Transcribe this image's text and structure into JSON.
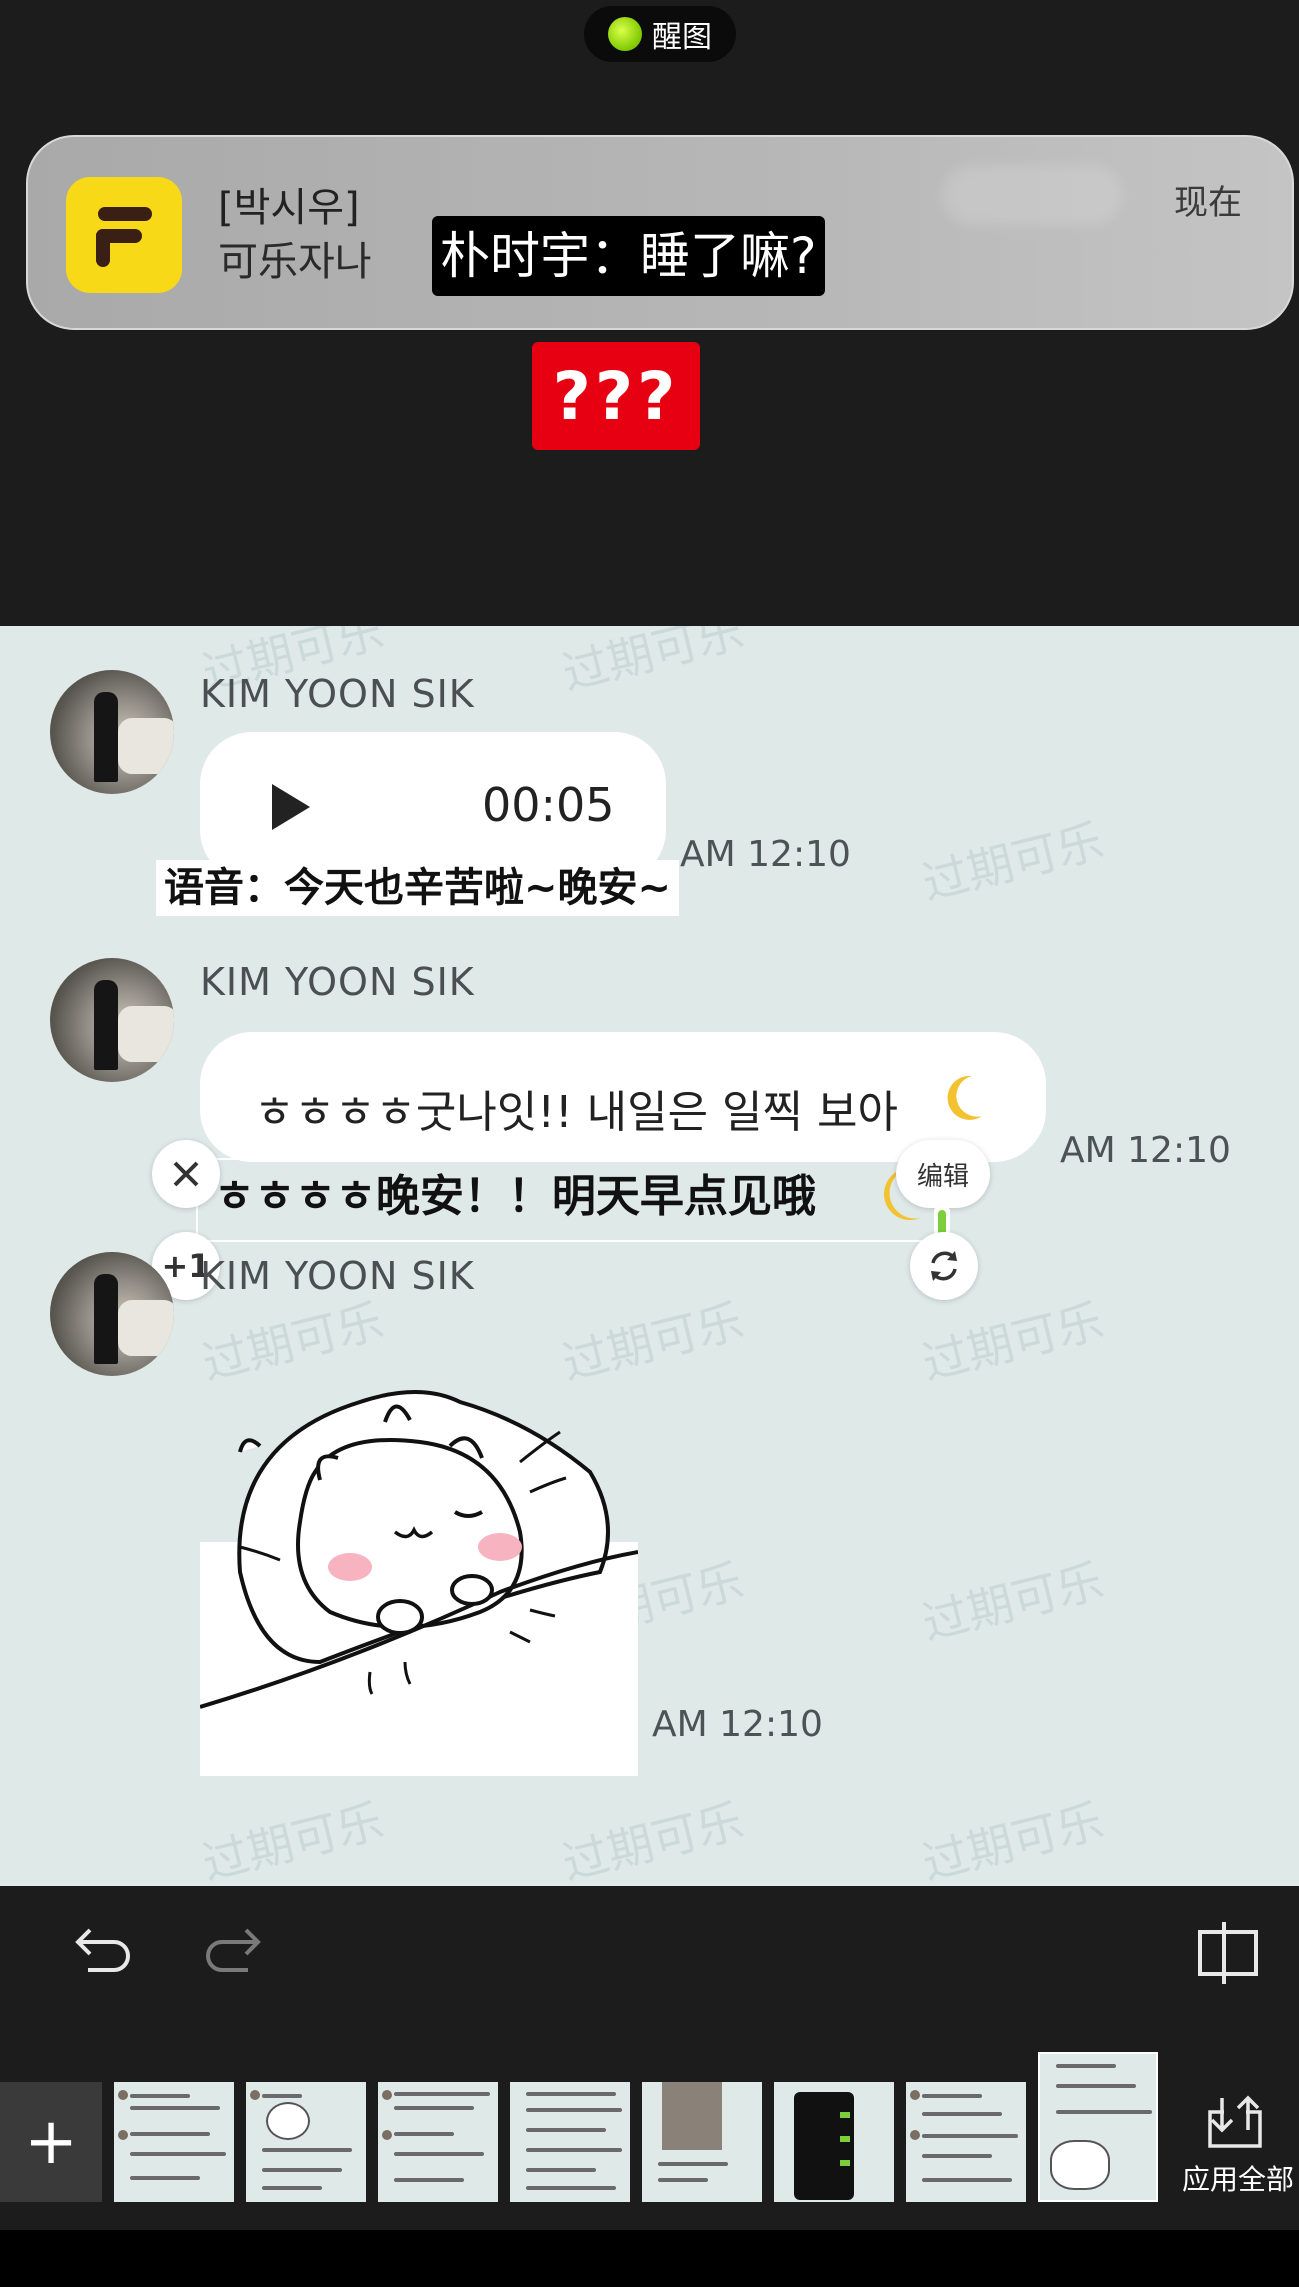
{
  "top_pill": {
    "label": "醒图"
  },
  "notification": {
    "title": "[박시우]",
    "subtitle": "可乐자나",
    "time": "现在",
    "overlay_text": "朴时宇：睡了嘛?",
    "question": "???"
  },
  "watermark": "过期可乐",
  "messages": [
    {
      "sender": "KIM YOON SIK",
      "type": "voice",
      "duration": "00:05",
      "time": "AM 12:10",
      "caption": "语音：今天也辛苦啦~晚安~"
    },
    {
      "sender": "KIM YOON SIK",
      "type": "text",
      "text": "ㅎㅎㅎㅎ굿나잇!! 내일은 일찍 보아",
      "time": "AM 12:10",
      "caption": "ㅎㅎㅎㅎ晚安！！明天早点见哦"
    },
    {
      "sender": "KIM YOON SIK",
      "type": "sticker",
      "sticker_icon": "sleeping-cat-sticker",
      "time": "AM 12:10"
    }
  ],
  "text_edit": {
    "edit_label": "编辑",
    "plus_label": "+1",
    "close_icon": "close-icon",
    "refresh_icon": "refresh-icon"
  },
  "toolbar": {
    "undo_icon": "undo-icon",
    "redo_icon": "redo-icon",
    "compare_icon": "compare-icon"
  },
  "thumbnails": {
    "add_label": "+",
    "apply_all_label": "应用全部",
    "count": 8
  },
  "colors": {
    "chat_bg": "#dfe9e8",
    "notif_accent": "#f7d917",
    "question_bg": "#e60012"
  }
}
